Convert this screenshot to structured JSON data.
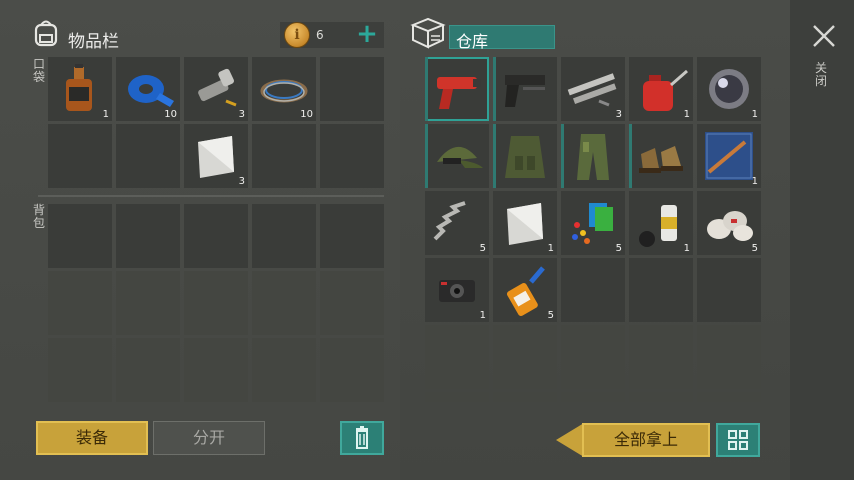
{
  "inventory": {
    "title": "物品栏",
    "coins": "6"
  },
  "warehouse": {
    "title": "仓库"
  },
  "labels": {
    "pocket": "口袋",
    "backpack": "背包",
    "close": "关闭"
  },
  "buttons": {
    "equip": "装备",
    "split": "分开",
    "take_all": "全部拿上"
  },
  "colors": {
    "accent_teal": "#2f7a72",
    "button_gold": "#c8a23a",
    "slot_bg": "#3a3c39"
  },
  "pocket_slots": [
    {
      "item": "whiskey-bottle",
      "qty": "1"
    },
    {
      "item": "blue-tape-roll",
      "qty": "10"
    },
    {
      "item": "flashlight",
      "qty": "3"
    },
    {
      "item": "wire-coil",
      "qty": "10"
    },
    {
      "item": "",
      "qty": ""
    },
    {
      "item": "",
      "qty": ""
    },
    {
      "item": "",
      "qty": ""
    },
    {
      "item": "metal-plate",
      "qty": "3"
    },
    {
      "item": "",
      "qty": ""
    },
    {
      "item": "",
      "qty": ""
    }
  ],
  "warehouse_slots": [
    {
      "item": "flare-gun",
      "qty": "",
      "selected": true
    },
    {
      "item": "pistol",
      "qty": ""
    },
    {
      "item": "metal-pipes",
      "qty": "3"
    },
    {
      "item": "oil-can",
      "qty": "1"
    },
    {
      "item": "lens",
      "qty": "1"
    },
    {
      "item": "camo-cap",
      "qty": ""
    },
    {
      "item": "tactical-vest",
      "qty": ""
    },
    {
      "item": "camo-pants",
      "qty": ""
    },
    {
      "item": "boots",
      "qty": ""
    },
    {
      "item": "rifle-blueprint",
      "qty": "1"
    },
    {
      "item": "spring",
      "qty": "5"
    },
    {
      "item": "metal-plate",
      "qty": "1"
    },
    {
      "item": "plastic-pieces",
      "qty": "5"
    },
    {
      "item": "spray-can",
      "qty": "1"
    },
    {
      "item": "bandages",
      "qty": "5"
    },
    {
      "item": "camera",
      "qty": "1"
    },
    {
      "item": "glue",
      "qty": "5"
    }
  ]
}
